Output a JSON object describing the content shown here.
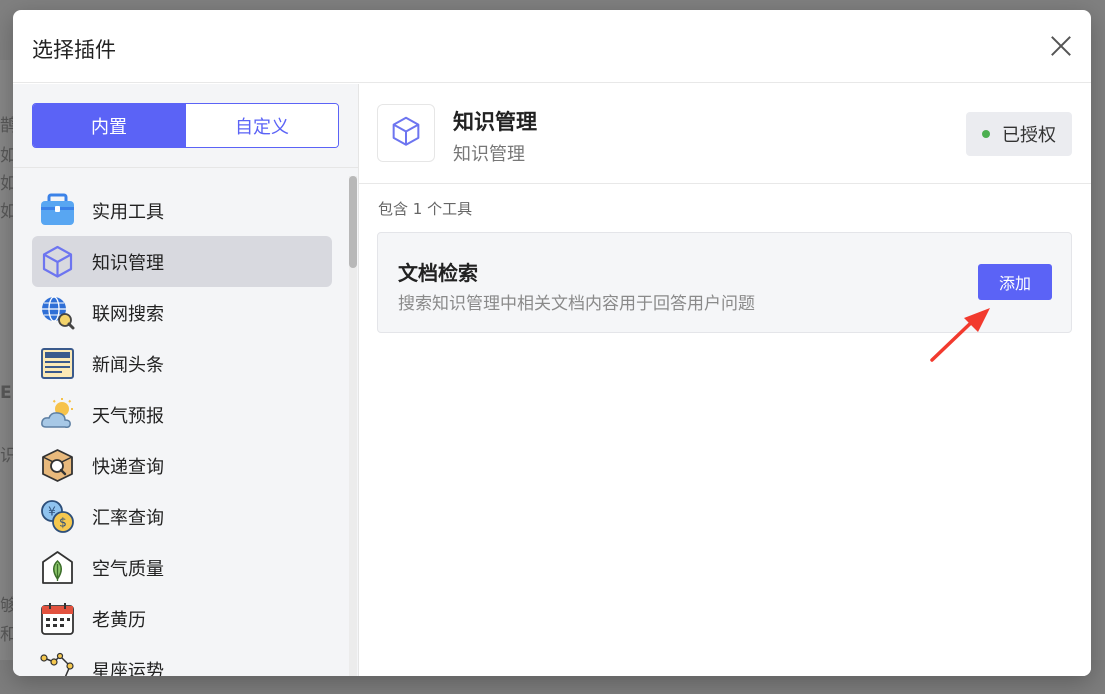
{
  "background": {
    "snippets": [
      "鹊",
      "如",
      "如",
      "如",
      "E",
      "识",
      "够",
      "和"
    ]
  },
  "modal": {
    "title": "选择插件",
    "tabs": [
      {
        "label": "内置",
        "active": true
      },
      {
        "label": "自定义",
        "active": false
      }
    ],
    "plugins": [
      {
        "label": "实用工具",
        "icon": "toolbox-icon",
        "selected": false
      },
      {
        "label": "知识管理",
        "icon": "cube-icon",
        "selected": true
      },
      {
        "label": "联网搜索",
        "icon": "globe-search-icon",
        "selected": false
      },
      {
        "label": "新闻头条",
        "icon": "newspaper-icon",
        "selected": false
      },
      {
        "label": "天气预报",
        "icon": "weather-icon",
        "selected": false
      },
      {
        "label": "快递查询",
        "icon": "package-search-icon",
        "selected": false
      },
      {
        "label": "汇率查询",
        "icon": "currency-exchange-icon",
        "selected": false
      },
      {
        "label": "空气质量",
        "icon": "air-quality-icon",
        "selected": false
      },
      {
        "label": "老黄历",
        "icon": "calendar-icon",
        "selected": false
      },
      {
        "label": "星座运势",
        "icon": "constellation-icon",
        "selected": false
      }
    ],
    "detail": {
      "title": "知识管理",
      "subtitle": "知识管理",
      "icon": "cube-icon",
      "badge": "已授权",
      "tools_count_text": "包含 1 个工具",
      "tools": [
        {
          "name": "文档检索",
          "description": "搜索知识管理中相关文档内容用于回答用户问题",
          "button_label": "添加"
        }
      ]
    }
  },
  "colors": {
    "accent": "#5b63f6",
    "badge_dot": "#4caf50",
    "annotation_arrow": "#f23a2e"
  }
}
